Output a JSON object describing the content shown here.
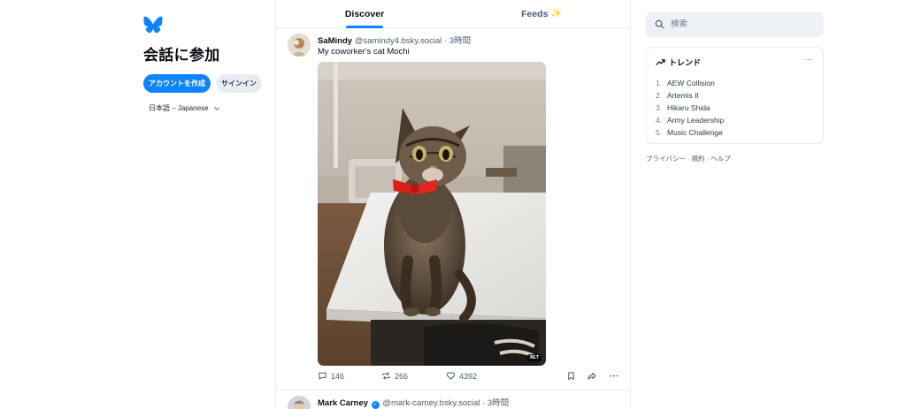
{
  "sidebar": {
    "title": "会話に参加",
    "create_account_label": "アカウントを作成",
    "sign_in_label": "サインイン",
    "language_label": "日本語 – Japanese",
    "brand_color": "#1083fe"
  },
  "feed": {
    "tabs": [
      {
        "label": "Discover",
        "active": true
      },
      {
        "label": "Feeds",
        "active": false
      }
    ],
    "posts": [
      {
        "display_name": "SaMindy",
        "handle": "@samindy4.bsky.social",
        "time": "· 3時間",
        "text": "My coworker's cat Mochi",
        "alt_badge": "ALT",
        "replies": "146",
        "reposts": "266",
        "likes": "4392"
      },
      {
        "display_name": "Mark Carney",
        "handle": "@mark-carney.bsky.social",
        "time": "· 3時間",
        "verified": true
      }
    ]
  },
  "right": {
    "search_placeholder": "検索",
    "trends_title": "トレンド",
    "trends_more": "···",
    "trends": [
      {
        "num": "1.",
        "label": "AEW Collision"
      },
      {
        "num": "2.",
        "label": "Artemis II"
      },
      {
        "num": "3.",
        "label": "Hikaru Shida"
      },
      {
        "num": "4.",
        "label": "Army Leadership"
      },
      {
        "num": "5.",
        "label": "Music Challenge"
      }
    ],
    "footer": {
      "privacy": "プライバシー",
      "sep1": " · ",
      "terms": "規約",
      "sep2": " · ",
      "help": "ヘルプ"
    }
  }
}
